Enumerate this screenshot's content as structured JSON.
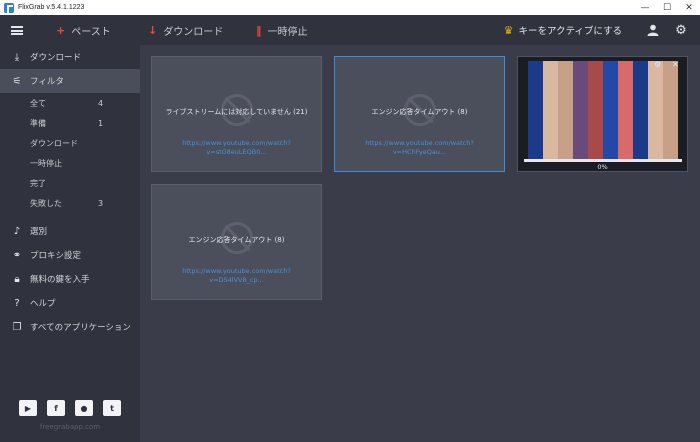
{
  "window": {
    "title": "FlixGrab  v.5.4.1.1223",
    "controls": [
      "—",
      "☐",
      "✕"
    ]
  },
  "toolbar": {
    "paste_label": "ペースト",
    "download_label": "ダウンロード",
    "pause_label": "一時停止",
    "activate_label": "キーをアクティブにする"
  },
  "sidebar": {
    "download_label": "ダウンロード",
    "filter_label": "フィルタ",
    "filters": [
      {
        "label": "全て",
        "count": "4"
      },
      {
        "label": "準備",
        "count": "1"
      },
      {
        "label": "ダウンロード",
        "count": ""
      },
      {
        "label": "一時停止",
        "count": ""
      },
      {
        "label": "完了",
        "count": ""
      },
      {
        "label": "失敗した",
        "count": "3"
      }
    ],
    "select_label": "選別",
    "proxy_label": "プロキシ設定",
    "free_key_label": "無料の鍵を入手",
    "help_label": "ヘルプ",
    "all_apps_label": "すべてのアプリケーション",
    "website": "freegrabapp.com"
  },
  "cards": [
    {
      "message": "ライブストリームには対応していません (21)",
      "url1": "https://www.youtube.com/watch?",
      "url2": "v=stG8euLEQB0..."
    },
    {
      "message": "エンジン応答タイムアウト (8)",
      "url1": "https://www.youtube.com/watch?",
      "url2": "v=HChFyeQau..."
    },
    {
      "message": "エンジン応答タイムアウト (8)",
      "url1": "https://www.youtube.com/watch?",
      "url2": "v=DS4lVV8_cp..."
    }
  ],
  "processing": {
    "progress_text": "0%",
    "progress": 0
  },
  "colors": {
    "accent_blue": "#3b8ed8",
    "paste_red": "#e8483a",
    "crown_gold": "#f0b400"
  }
}
